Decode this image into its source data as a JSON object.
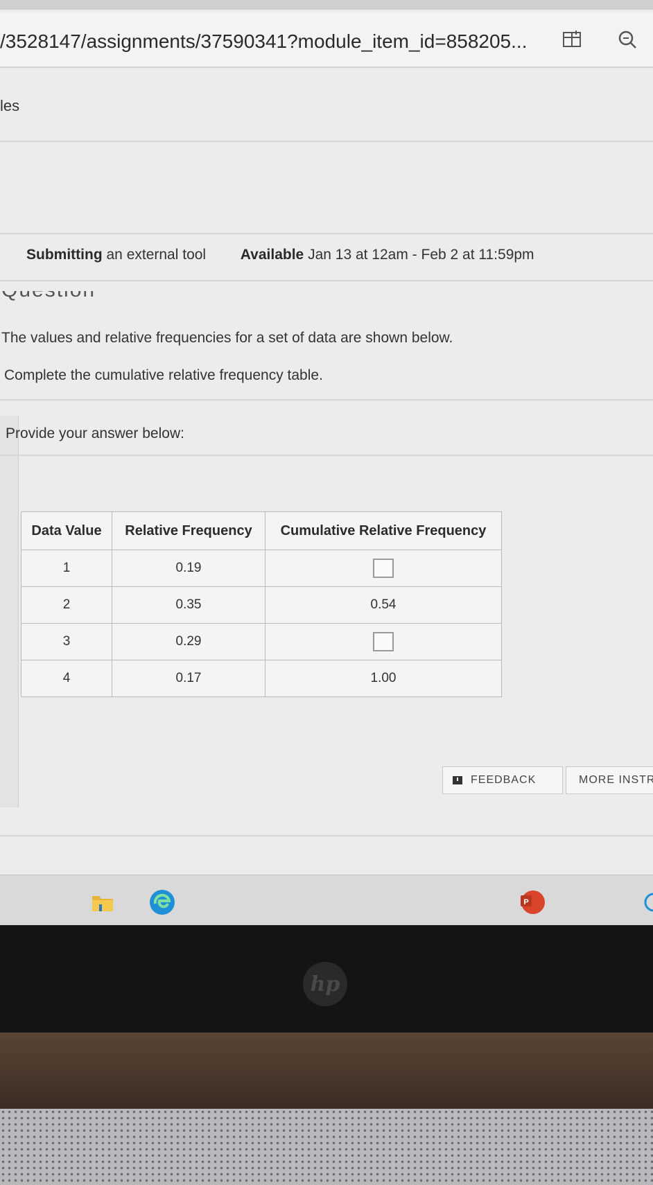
{
  "browser": {
    "url": "/3528147/assignments/37590341?module_item_id=858205..."
  },
  "breadcrumb": "les",
  "assignment": {
    "submitting_label": "Submitting",
    "submitting_value": "an external tool",
    "available_label": "Available",
    "available_value": "Jan 13 at 12am - Feb 2 at 11:59pm"
  },
  "question": {
    "heading": "Question",
    "line1": "The values and relative frequencies for a set of data are shown below.",
    "line2": "Complete the cumulative relative frequency table.",
    "answer_prompt": "Provide your answer below:"
  },
  "table": {
    "headers": [
      "Data Value",
      "Relative Frequency",
      "Cumulative Relative Frequency"
    ],
    "rows": [
      {
        "value": "1",
        "rel": "0.19",
        "cum": ""
      },
      {
        "value": "2",
        "rel": "0.35",
        "cum": "0.54"
      },
      {
        "value": "3",
        "rel": "0.29",
        "cum": ""
      },
      {
        "value": "4",
        "rel": "0.17",
        "cum": "1.00"
      }
    ]
  },
  "buttons": {
    "feedback": "FEEDBACK",
    "more_instr": "MORE INSTR"
  },
  "taskbar": {
    "powerpoint_letter": "P"
  },
  "laptop": {
    "brand": "hp"
  }
}
